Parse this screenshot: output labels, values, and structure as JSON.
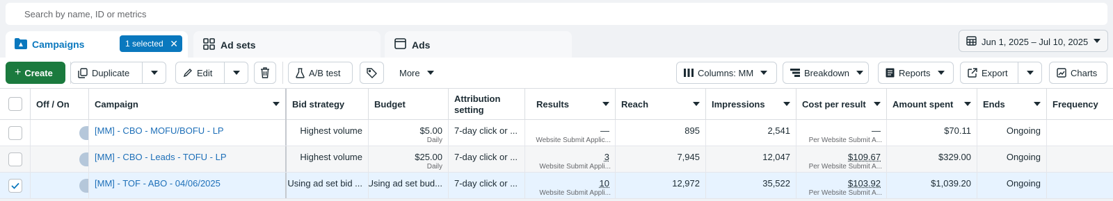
{
  "search": {
    "placeholder": "Search by name, ID or metrics"
  },
  "tabs": {
    "campaigns": {
      "label": "Campaigns",
      "selected_chip": "1 selected"
    },
    "adsets": {
      "label": "Ad sets"
    },
    "ads": {
      "label": "Ads"
    }
  },
  "date_range": "Jun 1, 2025 – Jul 10, 2025",
  "toolbar": {
    "create": "Create",
    "duplicate": "Duplicate",
    "edit": "Edit",
    "ab_test": "A/B test",
    "more": "More",
    "columns": "Columns: MM",
    "breakdown": "Breakdown",
    "reports": "Reports",
    "export": "Export",
    "charts": "Charts"
  },
  "columns": {
    "off_on": "Off / On",
    "campaign": "Campaign",
    "bid_strategy": "Bid strategy",
    "budget": "Budget",
    "attribution_1": "Attribution",
    "attribution_2": "setting",
    "results": "Results",
    "reach": "Reach",
    "impressions": "Impressions",
    "cost_per_result": "Cost per result",
    "amount_spent": "Amount spent",
    "ends": "Ends",
    "frequency": "Frequency"
  },
  "rows": [
    {
      "checked": false,
      "on": true,
      "campaign": "[MM] - CBO - MOFU/BOFU - LP",
      "bid_strategy": "Highest volume",
      "budget": "$5.00",
      "budget_sub": "Daily",
      "attribution": "7-day click or ...",
      "results": "—",
      "results_sub": "Website Submit Applic...",
      "reach": "895",
      "impressions": "2,541",
      "cost_per_result": "—",
      "cost_sub": "Per Website Submit A...",
      "amount_spent": "$70.11",
      "ends": "Ongoing",
      "frequency": ""
    },
    {
      "checked": false,
      "on": true,
      "campaign": "[MM] - CBO - Leads - TOFU - LP",
      "bid_strategy": "Highest volume",
      "budget": "$25.00",
      "budget_sub": "Daily",
      "attribution": "7-day click or ...",
      "results": "3",
      "results_sub": "Website Submit Appli...",
      "reach": "7,945",
      "impressions": "12,047",
      "cost_per_result": "$109.67",
      "cost_sub": "Per Website Submit A...",
      "amount_spent": "$329.00",
      "ends": "Ongoing",
      "frequency": ""
    },
    {
      "checked": true,
      "on": true,
      "campaign": "[MM] - TOF - ABO - 04/06/2025",
      "bid_strategy": "Using ad set bid ...",
      "budget": "Using ad set bud...",
      "budget_sub": "",
      "attribution": "7-day click or ...",
      "results": "10",
      "results_sub": "Website Submit Appli...",
      "reach": "12,972",
      "impressions": "35,522",
      "cost_per_result": "$103.92",
      "cost_sub": "Per Website Submit A...",
      "amount_spent": "$1,039.20",
      "ends": "Ongoing",
      "frequency": ""
    }
  ],
  "colors": {
    "brand_blue": "#0a78be",
    "create_green": "#1b7a3e",
    "row_selected": "#e7f3ff"
  }
}
